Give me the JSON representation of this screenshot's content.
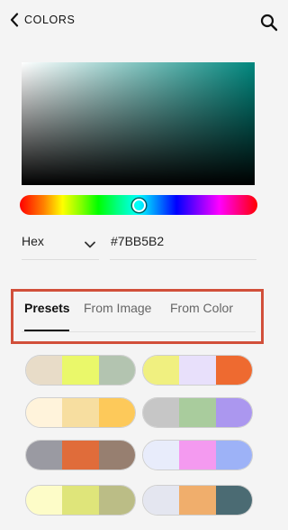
{
  "header": {
    "title": "COLORS",
    "back_icon": "chevron-left-icon",
    "search_icon": "search-icon"
  },
  "picker": {
    "base_hue_color": "#00877e",
    "hue_value_percent": 50,
    "format": "Hex",
    "format_icon": "chevron-down-icon",
    "hex_value": "#7BB5B2"
  },
  "tabs": [
    {
      "label": "Presets",
      "active": true
    },
    {
      "label": "From Image",
      "active": false
    },
    {
      "label": "From Color",
      "active": false
    }
  ],
  "highlight_color": "#d14f3a",
  "presets": [
    [
      "#e8dcc8",
      "#eaf86a",
      "#b3c4b0"
    ],
    [
      "#f0f080",
      "#e8e0fb",
      "#ee6a30"
    ],
    [
      "#fff3db",
      "#f7dea0",
      "#fdc95a"
    ],
    [
      "#c6c6c6",
      "#a9cc9d",
      "#ab97ef"
    ],
    [
      "#9a9aa2",
      "#e06c3a",
      "#977f70"
    ],
    [
      "#e8ecfb",
      "#f49af0",
      "#9db2f7"
    ],
    [
      "#fdfcc8",
      "#dfe57a",
      "#bbbd86"
    ],
    [
      "#e4e6f0",
      "#f0ae6c",
      "#4b6b73"
    ]
  ]
}
